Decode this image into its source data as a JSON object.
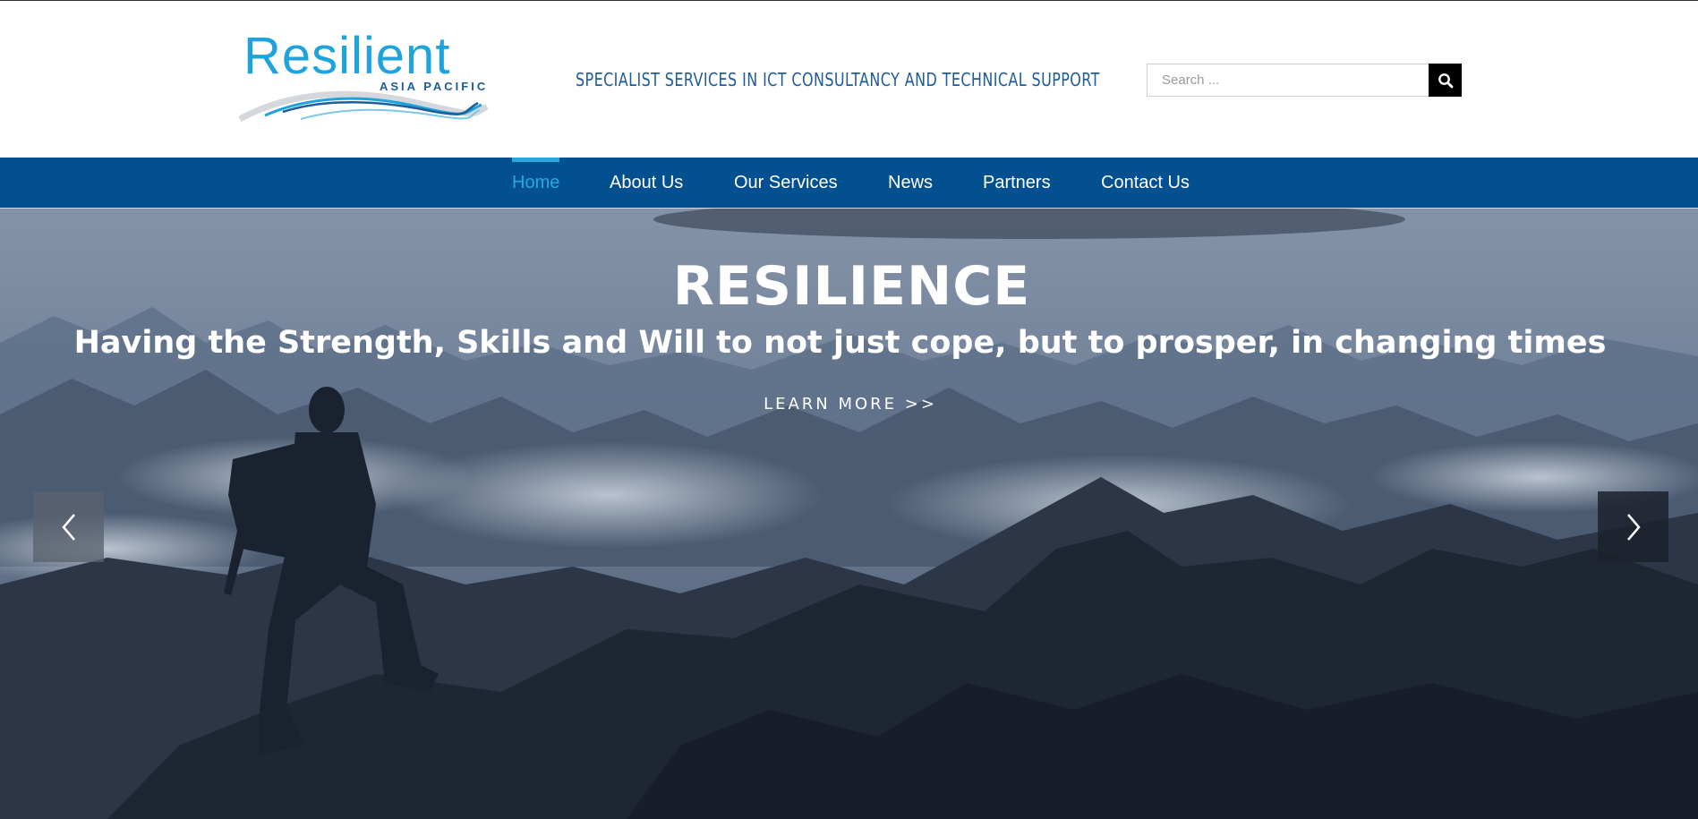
{
  "logo": {
    "word": "Resilient",
    "sub": "ASIA PACIFIC"
  },
  "header": {
    "tagline": "SPECIALIST SERVICES IN ICT CONSULTANCY AND TECHNICAL SUPPORT"
  },
  "search": {
    "placeholder": "Search ...",
    "icon": "search-icon"
  },
  "nav": {
    "items": [
      {
        "label": "Home",
        "active": true
      },
      {
        "label": "About Us",
        "active": false
      },
      {
        "label": "Our Services",
        "active": false
      },
      {
        "label": "News",
        "active": false
      },
      {
        "label": "Partners",
        "active": false
      },
      {
        "label": "Contact Us",
        "active": false
      }
    ]
  },
  "hero": {
    "title": "RESILIENCE",
    "subtitle": "Having the Strength, Skills and Will to not just cope, but to prosper, in changing times",
    "cta": "LEARN MORE >>",
    "prev_icon": "chevron-left-icon",
    "next_icon": "chevron-right-icon"
  },
  "colors": {
    "brand_blue": "#02508f",
    "accent_cyan": "#29a8df",
    "tagline_blue": "#1f5c9a"
  }
}
